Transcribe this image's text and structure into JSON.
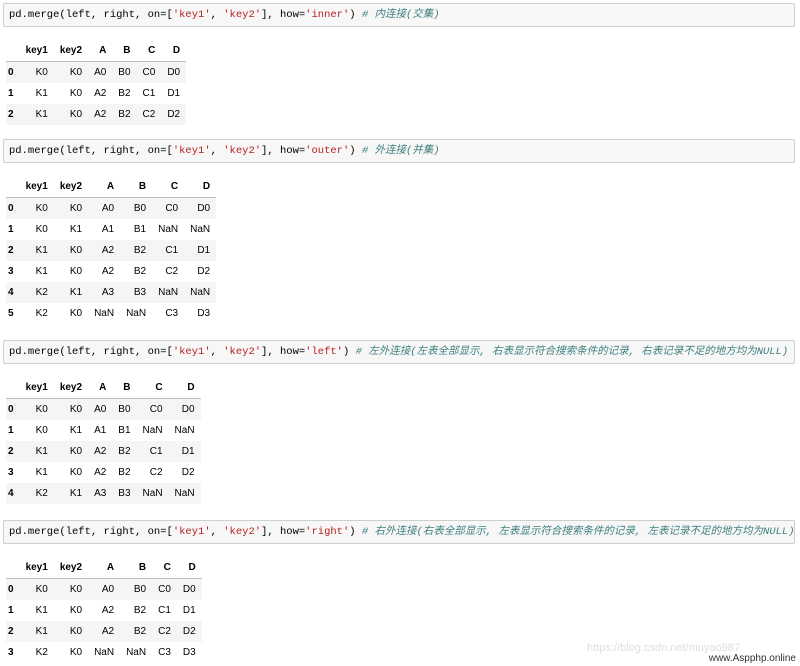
{
  "cells": [
    {
      "code_prefix": "pd.merge(left, right, on=[",
      "s1": "'key1'",
      "sep1": ", ",
      "s2": "'key2'",
      "mid": "], how=",
      "how": "'inner'",
      "close": ")",
      "comment": " # 内连接(交集)",
      "table": {
        "columns": [
          "",
          "key1",
          "key2",
          "A",
          "B",
          "C",
          "D"
        ],
        "rows": [
          [
            "0",
            "K0",
            "K0",
            "A0",
            "B0",
            "C0",
            "D0"
          ],
          [
            "1",
            "K1",
            "K0",
            "A2",
            "B2",
            "C1",
            "D1"
          ],
          [
            "2",
            "K1",
            "K0",
            "A2",
            "B2",
            "C2",
            "D2"
          ]
        ]
      }
    },
    {
      "code_prefix": "pd.merge(left, right, on=[",
      "s1": "'key1'",
      "sep1": ", ",
      "s2": "'key2'",
      "mid": "], how=",
      "how": "'outer'",
      "close": ")",
      "comment": " # 外连接(并集)",
      "table": {
        "columns": [
          "",
          "key1",
          "key2",
          "A",
          "B",
          "C",
          "D"
        ],
        "rows": [
          [
            "0",
            "K0",
            "K0",
            "A0",
            "B0",
            "C0",
            "D0"
          ],
          [
            "1",
            "K0",
            "K1",
            "A1",
            "B1",
            "NaN",
            "NaN"
          ],
          [
            "2",
            "K1",
            "K0",
            "A2",
            "B2",
            "C1",
            "D1"
          ],
          [
            "3",
            "K1",
            "K0",
            "A2",
            "B2",
            "C2",
            "D2"
          ],
          [
            "4",
            "K2",
            "K1",
            "A3",
            "B3",
            "NaN",
            "NaN"
          ],
          [
            "5",
            "K2",
            "K0",
            "NaN",
            "NaN",
            "C3",
            "D3"
          ]
        ]
      }
    },
    {
      "code_prefix": "pd.merge(left, right, on=[",
      "s1": "'key1'",
      "sep1": ", ",
      "s2": "'key2'",
      "mid": "], how=",
      "how": "'left'",
      "close": ")",
      "comment": " # 左外连接(左表全部显示, 右表显示符合搜索条件的记录, 右表记录不足的地方均为NULL)",
      "table": {
        "columns": [
          "",
          "key1",
          "key2",
          "A",
          "B",
          "C",
          "D"
        ],
        "rows": [
          [
            "0",
            "K0",
            "K0",
            "A0",
            "B0",
            "C0",
            "D0"
          ],
          [
            "1",
            "K0",
            "K1",
            "A1",
            "B1",
            "NaN",
            "NaN"
          ],
          [
            "2",
            "K1",
            "K0",
            "A2",
            "B2",
            "C1",
            "D1"
          ],
          [
            "3",
            "K1",
            "K0",
            "A2",
            "B2",
            "C2",
            "D2"
          ],
          [
            "4",
            "K2",
            "K1",
            "A3",
            "B3",
            "NaN",
            "NaN"
          ]
        ]
      }
    },
    {
      "code_prefix": "pd.merge(left, right, on=[",
      "s1": "'key1'",
      "sep1": ", ",
      "s2": "'key2'",
      "mid": "], how=",
      "how": "'right'",
      "close": ")",
      "comment": " # 右外连接(右表全部显示, 左表显示符合搜索条件的记录, 左表记录不足的地方均为NULL)",
      "table": {
        "columns": [
          "",
          "key1",
          "key2",
          "A",
          "B",
          "C",
          "D"
        ],
        "rows": [
          [
            "0",
            "K0",
            "K0",
            "A0",
            "B0",
            "C0",
            "D0"
          ],
          [
            "1",
            "K1",
            "K0",
            "A2",
            "B2",
            "C1",
            "D1"
          ],
          [
            "2",
            "K1",
            "K0",
            "A2",
            "B2",
            "C2",
            "D2"
          ],
          [
            "3",
            "K2",
            "K0",
            "NaN",
            "NaN",
            "C3",
            "D3"
          ]
        ]
      }
    }
  ],
  "watermark": "https://blog.csdn.net/muyao987",
  "watermark2": "www.Aspphp.online"
}
